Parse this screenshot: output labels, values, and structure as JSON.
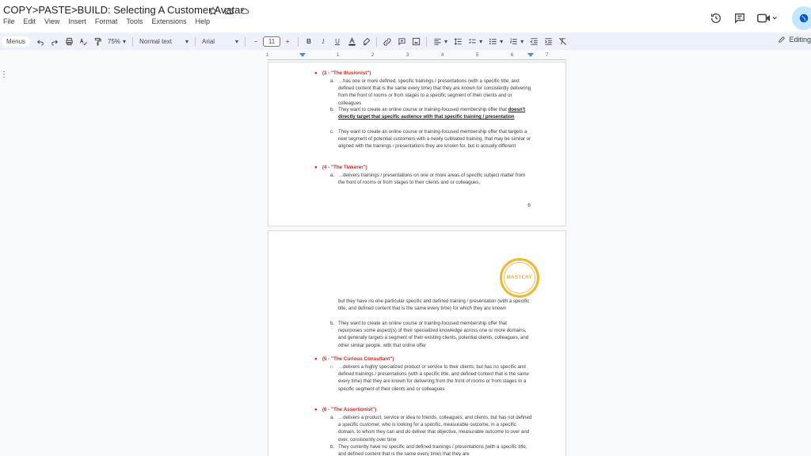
{
  "window": {
    "doc_title": "COPY>PASTE>BUILD: Selecting A Customer Avatar"
  },
  "menu": {
    "items": [
      "File",
      "Edit",
      "View",
      "Insert",
      "Format",
      "Tools",
      "Extensions",
      "Help"
    ]
  },
  "toolbar": {
    "menus_label": "Menus",
    "zoom": "75%",
    "style": "Normal text",
    "font": "Arial",
    "font_size": "11",
    "editing_label": "Editing"
  },
  "ruler": {
    "numbers": [
      "1",
      "1",
      "2",
      "3",
      "4",
      "5",
      "6",
      "7"
    ]
  },
  "page1": {
    "h3": "(3 - \"The Illusionist\")",
    "h3_a_mark": "a.",
    "h3_a": "…has one or more defined, specific trainings / presentations (with a specific title, and defined content that is the same every time) that they are known for consistently delivering from the front of rooms or from stages to a specific segment of their clients and or colleagues",
    "h3_b_mark": "b.",
    "h3_b_pre": "They want to create an online course or training-focused membership offer that",
    "h3_b_emph": "doesn't directly target that specific audience with that specific training / presentation",
    "h3_c_mark": "c.",
    "h3_c": "They want to create an online course or training-focused membership offer that targets a new segment of potential customers with a newly cultivated training, that may be similar or aligned with the trainings / presentations they are known for, but is actually different",
    "h4": "(4 - \"The Tinkerer\")",
    "h4_a_mark": "a.",
    "h4_a": "…delivers trainings / presentations on one or more areas of specific subject matter from the front of rooms or from stages to their clients and or colleagues,",
    "page_number": "6"
  },
  "page2": {
    "seal_text": "MASTERY",
    "cont_text": "but they have no one particular specific and defined training / presentation (with a specific title, and defined content that is the same every time) for which they are known",
    "cont_b_mark": "b.",
    "cont_b": "They want to create an online course or training-focused membership offer that repurposes some aspect(s) of their specialized knowledge across one or more domains, and generally targets a segment of their existing clients, potential clients, colleagues, and other similar people, with that online offer",
    "h5": "(5 - \"The Curious Consultant\")",
    "h5_a_mark": "○",
    "h5_a": "…delivers a highly specialized product or service to their clients, but has no specific and defined trainings / presentations (with a specific title, and defined content that is the same every time) that they are known for delivering from the front of rooms or from stages to a specific segment of their clients and or colleagues",
    "h6": "(6 - \"The Assertionist\")",
    "h6_a_mark": "a.",
    "h6_a": "…delivers a product, service or idea to friends, colleagues, and clients, but has not defined a specific customer, who is looking for a specific, measurable outcome, in a specific domain, to whom they can and do deliver that objective, measurable outcome to over and over, consistently over time",
    "h6_b_mark": "b.",
    "h6_b": "They currently have no specific and defined trainings / presentations (with a specific title, and defined content that is the same every time) that they are"
  }
}
